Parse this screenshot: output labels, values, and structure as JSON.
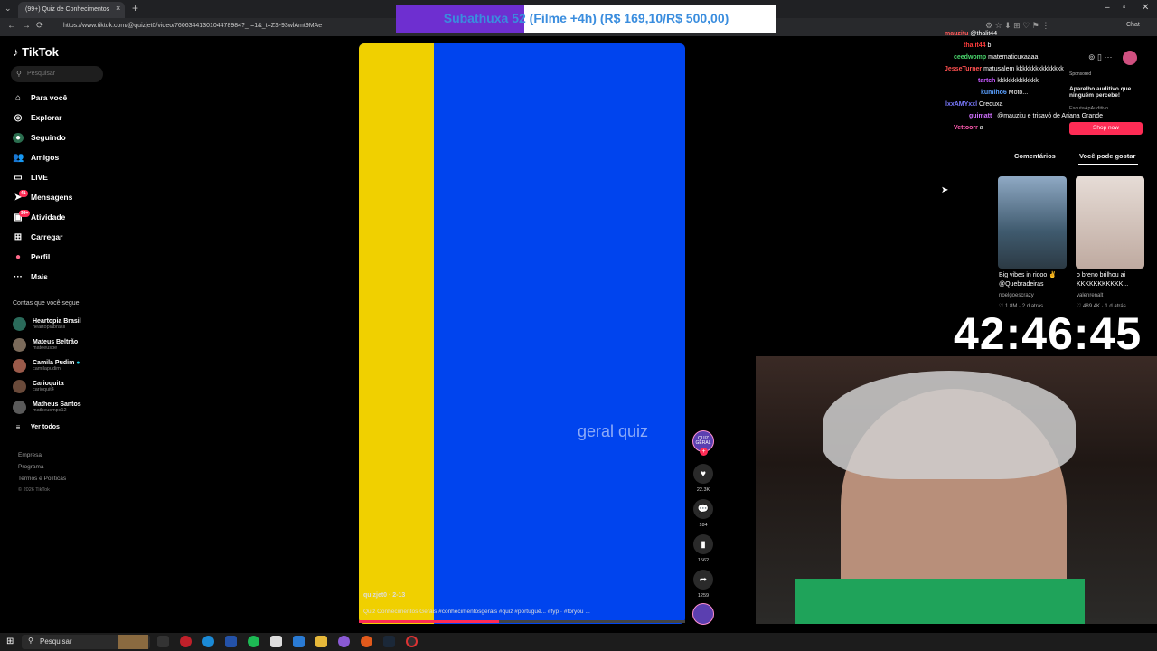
{
  "browser": {
    "tab_title": "(99+) Quiz de Conhecimentos",
    "tab_close": "×",
    "new_tab": "+",
    "url": "https://www.tiktok.com/@quizjet0/video/7606344130104478984?_r=1&_t=ZS-93wlAmt9MAe",
    "back": "←",
    "forward": "→",
    "reload": "⟳",
    "chat_label": "Chat"
  },
  "overlay": {
    "banner": "Subathuxa 52 (Filme +4h) (R$ 169,10/R$ 500,00)",
    "banner_progress": 0.338,
    "timer": "42:46:45"
  },
  "sidebar": {
    "logo": "TikTok",
    "search_placeholder": "Pesquisar",
    "nav": [
      {
        "label": "Para você",
        "icon": "home-icon"
      },
      {
        "label": "Explorar",
        "icon": "compass-icon"
      },
      {
        "label": "Seguindo",
        "icon": "following-icon"
      },
      {
        "label": "Amigos",
        "icon": "friends-icon"
      },
      {
        "label": "LIVE",
        "icon": "live-icon"
      },
      {
        "label": "Mensagens",
        "icon": "message-icon",
        "badge": "41"
      },
      {
        "label": "Atividade",
        "icon": "activity-icon",
        "badge": "99+"
      },
      {
        "label": "Carregar",
        "icon": "upload-icon"
      },
      {
        "label": "Perfil",
        "icon": "profile-icon"
      },
      {
        "label": "Mais",
        "icon": "more-icon"
      }
    ],
    "following_title": "Contas que você segue",
    "accounts": [
      {
        "name": "Heartopia Brasil",
        "handle": "heartopiabrasil"
      },
      {
        "name": "Mateus Beltrão",
        "handle": "mateeusbe"
      },
      {
        "name": "Camila Pudim",
        "handle": "camilapudim"
      },
      {
        "name": "Carioquita",
        "handle": "carioquit4"
      },
      {
        "name": "Matheus Santos",
        "handle": "matheusmps12"
      }
    ],
    "see_all": "Ver todos",
    "footer": [
      "Empresa",
      "Programa",
      "Termos e Políticas",
      "© 2026 TikTok"
    ]
  },
  "video": {
    "watermark": "geral quiz",
    "author": "quizjet0 · 2-13",
    "caption": "Quiz Conhecimentos Gerais #conhecimentosgerais #quiz #portuguê... #fyp · #foryou ...",
    "progress": 0.43,
    "likes": "22.3K",
    "comments": "184",
    "saves": "1562",
    "shares": "1259",
    "creator_badge": "QUIZ GERAL",
    "colors": {
      "left": "#f0d000",
      "right": "#0044ee"
    }
  },
  "chat": [
    {
      "user": "mauzitu",
      "text": "@thalit44",
      "color": "#ff5a5a"
    },
    {
      "user": "thalit44",
      "text": "b",
      "color": "#ff3b3b"
    },
    {
      "user": "ceedwomp",
      "text": "matematicuxaaaa",
      "color": "#4ad66d"
    },
    {
      "user": "JesseTurner",
      "text": "matusalem kkkkkkkkkkkkkkk",
      "color": "#ff5050"
    },
    {
      "user": "tartch",
      "text": "kkkkkkkkkkkkk",
      "color": "#c658ff"
    },
    {
      "user": "kumiho6",
      "text": "Moto...",
      "color": "#5aa0ff"
    },
    {
      "user": "lxxAMYxxl",
      "text": "Crequxa",
      "color": "#7a7aff"
    },
    {
      "user": "guimatt_",
      "text": "@mauzitu e trisavó de Ariana Grande",
      "color": "#d070ff"
    },
    {
      "user": "Vettoorr",
      "text": "a",
      "color": "#ff5ab0"
    }
  ],
  "ad": {
    "sponsored": "Sponsored",
    "title": "Aparelho auditivo que ninguém percebe!",
    "brand": "EscutaApAuditivo",
    "cta": "Shop now"
  },
  "right_tabs": {
    "comments": "Comentários",
    "suggested": "Você pode gostar"
  },
  "suggested": [
    {
      "caption": "Big vibes in riooo ✌ @Quebradeiras",
      "user": "noelgoescrazy",
      "stats": "♡ 1.8M · 2 d atrás",
      "color": "#5a7a9a"
    },
    {
      "caption": "o breno brilhou ai KKKKKKKKKKK...",
      "user": "valenrenalt",
      "stats": "♡ 489.4K · 1 d atrás",
      "color": "#c9b7ad"
    }
  ],
  "taskbar": {
    "search": "Pesquisar"
  }
}
